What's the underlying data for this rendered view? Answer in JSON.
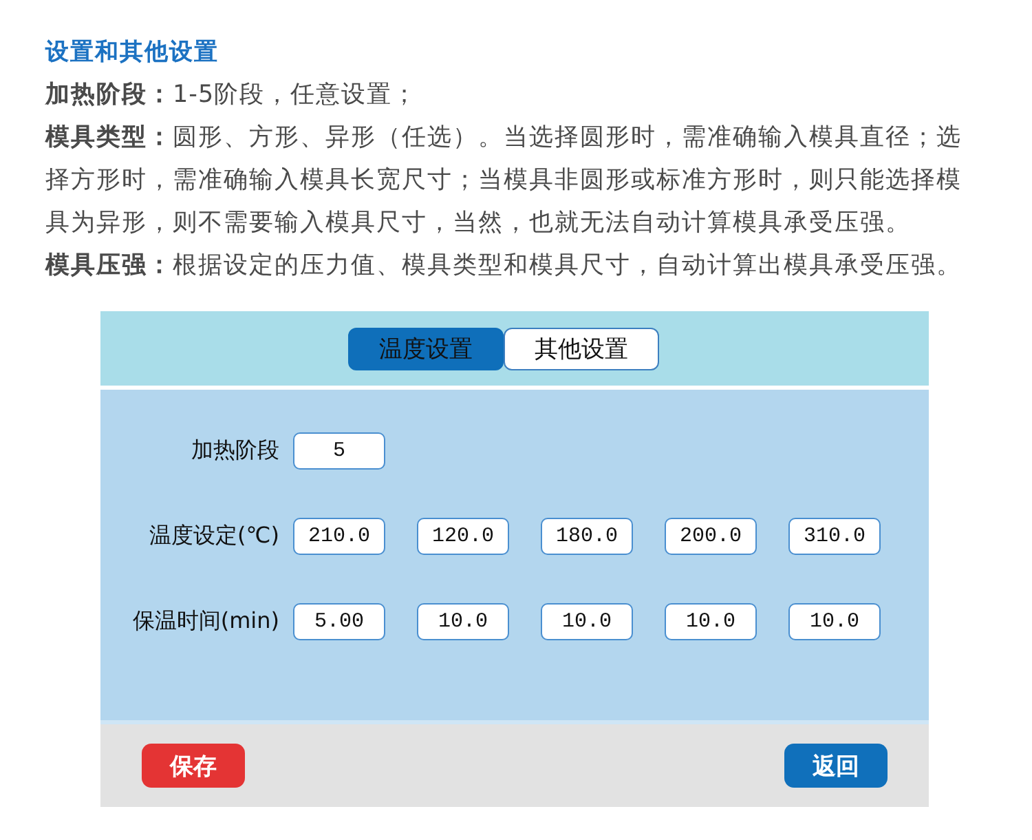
{
  "intro": {
    "title": "设置和其他设置",
    "paragraphs": [
      "**加热阶段：**1-5阶段，任意设置；",
      "**模具类型：**圆形、方形、异形（任选）。当选择圆形时，需准确输入模具直径；选择方形时，需准确输入模具长宽尺寸；当模具非圆形或标准方形时，则只能选择模具为异形，则不需要输入模具尺寸，当然，也就无法自动计算模具承受压强。",
      "**模具压强：**根据设定的压力值、模具类型和模具尺寸，自动计算出模具承受压强。"
    ]
  },
  "panel": {
    "tabs": [
      {
        "label": "温度设置",
        "selected": true
      },
      {
        "label": "其他设置",
        "selected": false
      }
    ],
    "rows": [
      {
        "label": "加热阶段",
        "values": [
          "5"
        ]
      },
      {
        "label": "温度设定(℃)",
        "values": [
          "210.0",
          "120.0",
          "180.0",
          "200.0",
          "310.0"
        ]
      },
      {
        "label": "保温时间(min)",
        "values": [
          "5.00",
          "10.0",
          "10.0",
          "10.0",
          "10.0"
        ]
      }
    ],
    "buttons": [
      {
        "label": "保存",
        "kind": "save"
      },
      {
        "label": "返回",
        "kind": "back"
      }
    ]
  }
}
